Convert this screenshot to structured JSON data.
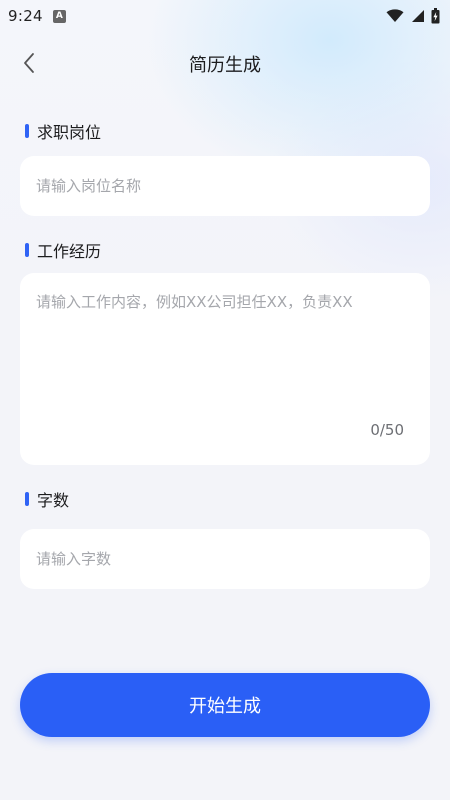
{
  "status_bar": {
    "time": "9:24",
    "notification_badge": "A",
    "icons": [
      "wifi-icon",
      "signal-icon",
      "battery-charging-icon"
    ]
  },
  "nav": {
    "title": "简历生成",
    "back_icon": "chevron-left-icon"
  },
  "form": {
    "position": {
      "label": "求职岗位",
      "placeholder": "请输入岗位名称",
      "value": ""
    },
    "experience": {
      "label": "工作经历",
      "placeholder": "请输入工作内容，例如XX公司担任XX，负责XX",
      "value": "",
      "counter": "0/50"
    },
    "word_count": {
      "label": "字数",
      "placeholder": "请输入字数",
      "value": ""
    }
  },
  "submit": {
    "label": "开始生成"
  },
  "colors": {
    "accent": "#2a5ff6",
    "label_bar": "#2f63f5",
    "background": "#f3f4f9",
    "card": "#ffffff",
    "placeholder": "#a5a7ac"
  }
}
